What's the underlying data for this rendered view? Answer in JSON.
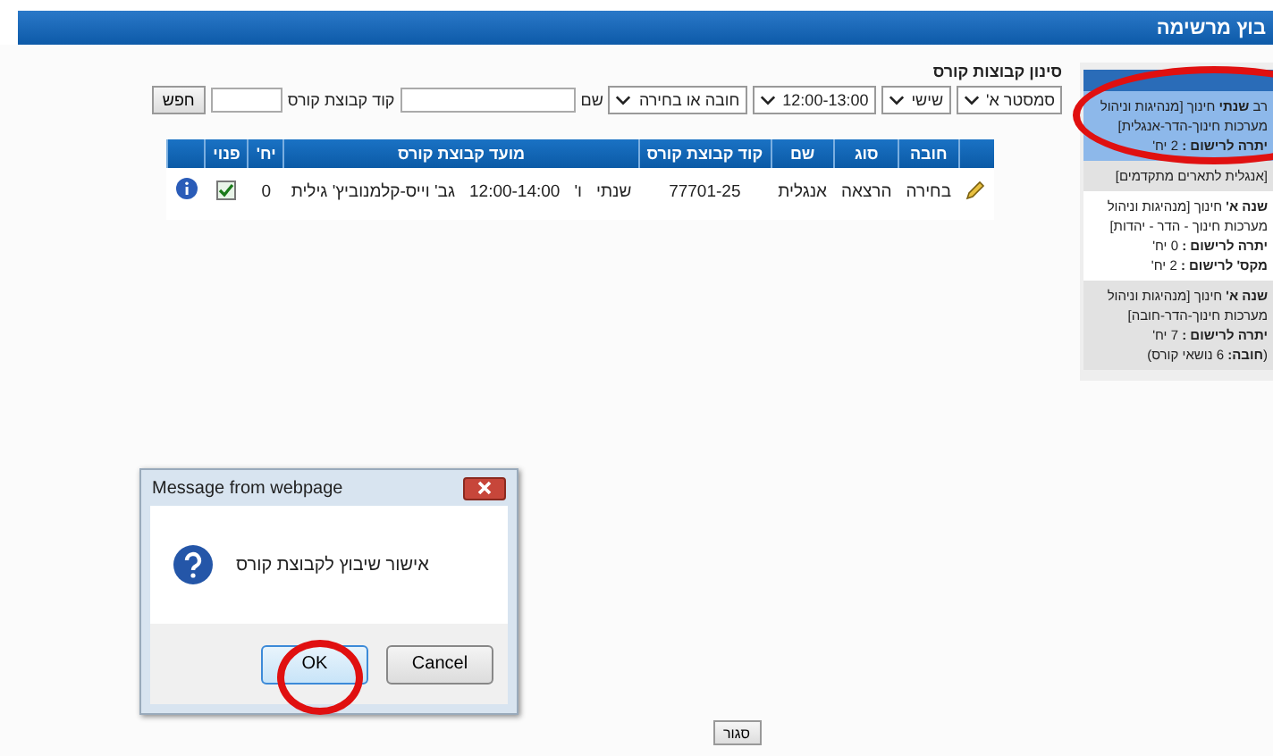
{
  "header": {
    "title": "בוץ מרשימה"
  },
  "filter": {
    "title": "סינון קבוצות קורס",
    "selects": [
      "סמסטר א'",
      "שישי",
      "12:00-13:00",
      "חובה או בחירה"
    ],
    "name_label": "שם",
    "code_label": "קוד קבוצת קורס",
    "search_button": "חפש"
  },
  "table": {
    "columns": [
      "חובה",
      "סוג",
      "שם",
      "קוד קבוצת קורס",
      "מועד קבוצת קורס",
      "יח'",
      "פנוי"
    ],
    "rows": [
      {
        "required": "בחירה",
        "type": "הרצאה",
        "name": "אנגלית",
        "code": "77701-25",
        "period": "שנתי",
        "day": "ו'",
        "time": "12:00-14:00",
        "lecturer": "גב' וייס-קלמנוביץ' גילית",
        "units": "0",
        "available": true
      }
    ]
  },
  "sidebar": {
    "items": [
      {
        "selected": true,
        "lines": [
          "רב **שנתי** חינוך [מנהיגות וניהול",
          "מערכות חינוך-הדר-אנגלית]",
          "**יתרה לרישום :** 2 יח'"
        ]
      },
      {
        "selected": false,
        "lines": [
          "[אנגלית לתארים מתקדמים]"
        ]
      },
      {
        "selected": false,
        "lines": [
          "**שנה א'** חינוך [מנהיגות וניהול",
          "מערכות חינוך - הדר - יהדות]",
          "**יתרה לרישום :** 0 יח'",
          "**מקס' לרישום :** 2 יח'"
        ]
      },
      {
        "selected": false,
        "lines": [
          "**שנה א'** חינוך [מנהיגות וניהול",
          "מערכות חינוך-הדר-חובה]",
          "**יתרה לרישום :** 7 יח'",
          "(**חובה:** 6 נושאי קורס)"
        ]
      }
    ]
  },
  "close_button": "סגור",
  "dialog": {
    "title": "Message from webpage",
    "message": "אישור שיבוץ לקבוצת קורס",
    "buttons": [
      {
        "label": "Cancel",
        "selected": false
      },
      {
        "label": "OK",
        "selected": true
      }
    ]
  }
}
